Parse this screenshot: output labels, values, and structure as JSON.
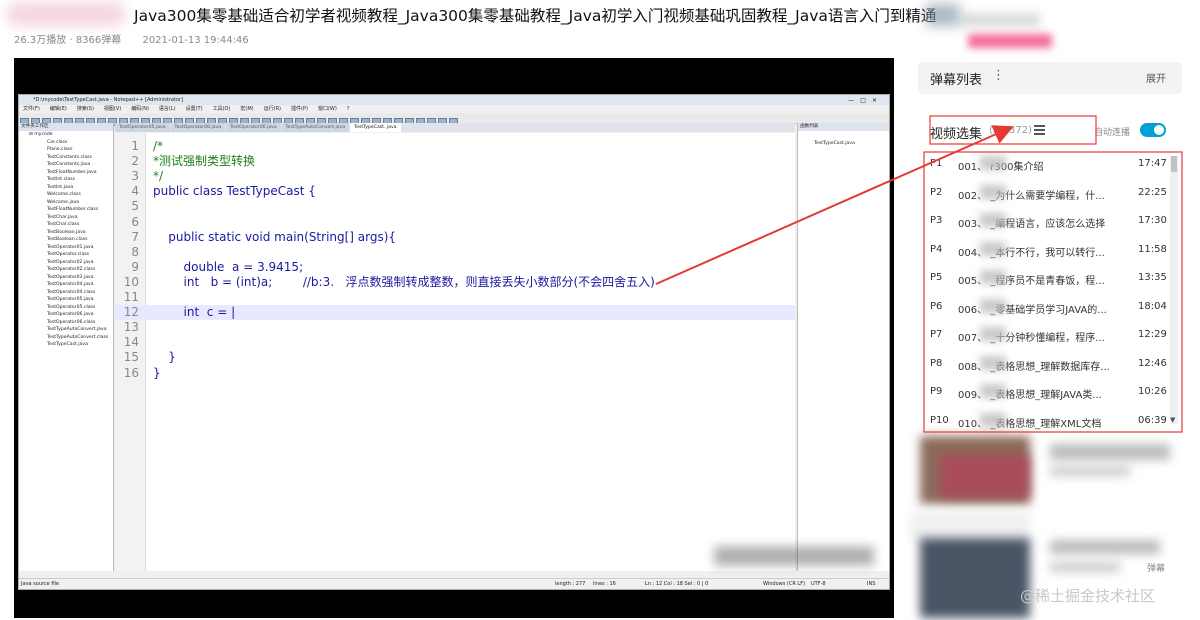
{
  "header": {
    "title": "Java300集零基础适合初学者视频教程_Java300集零基础教程_Java初学入门视频基础巩固教程_Java语言入门到精通",
    "plays": "26.3万播放",
    "danmaku_count": "8366弹幕",
    "date": "2021-01-13 19:44:46",
    "separator": " · "
  },
  "player": {
    "npp_title": "*D:\\mycode\\TestTypeCast.java - Notepad++ [Administrator]",
    "npp_menu": [
      "文件(F)",
      "编辑(E)",
      "搜索(S)",
      "视图(V)",
      "编码(N)",
      "语言(L)",
      "设置(T)",
      "工具(O)",
      "宏(M)",
      "运行(R)",
      "插件(P)",
      "窗口(W)",
      "?"
    ],
    "panel_title": "文件夹工作区",
    "folder": "mycode",
    "files": [
      "Car.class",
      "Plane.class",
      "TestConstants.class",
      "TestConstants.java",
      "TestFloatNumber.java",
      "TestInt.class",
      "TestInt.java",
      "Welcome.class",
      "Welcome.java",
      "TestFloatNumber.class",
      "TestChar.java",
      "TestChar.class",
      "TestBoolean.java",
      "TestBoolean.class",
      "TestOperator01.java",
      "TestOperator.class",
      "TestOperator02.java",
      "TestOperator02.class",
      "TestOperator03.java",
      "TestOperator04.java",
      "TestOperator04.class",
      "TestOperator05.java",
      "TestOperator05.class",
      "TestOperator06.java",
      "TestOperator06.class",
      "TestTypeAutoConvert.java",
      "TestTypeAutoConvert.class",
      "TestTypeCast.java"
    ],
    "tabs": [
      "TestOperator05.java",
      "TestOperator06.java",
      "TestOperator06.java",
      "TestTypeAutoConvert.java",
      "TestTypeCast. java"
    ],
    "right_panel_title": "函数列表",
    "right_panel_file": "TestTypeCast.java",
    "code_lines": [
      {
        "n": "1",
        "t": "/*"
      },
      {
        "n": "2",
        "t": "*测试强制类型转换"
      },
      {
        "n": "3",
        "t": "*/"
      },
      {
        "n": "4",
        "t": "public class TestTypeCast {"
      },
      {
        "n": "5",
        "t": ""
      },
      {
        "n": "6",
        "t": ""
      },
      {
        "n": "7",
        "t": "    public static void main(String[] args){"
      },
      {
        "n": "8",
        "t": ""
      },
      {
        "n": "9",
        "t": "        double  a = 3.9415;"
      },
      {
        "n": "10",
        "t": "        int   b = (int)a;        //b:3.   浮点数强制转成整数，则直接丢失小数部分(不会四舍五入)"
      },
      {
        "n": "11",
        "t": ""
      },
      {
        "n": "12",
        "t": "        int  c = |"
      },
      {
        "n": "13",
        "t": ""
      },
      {
        "n": "14",
        "t": ""
      },
      {
        "n": "15",
        "t": "    }"
      },
      {
        "n": "16",
        "t": "}"
      }
    ],
    "status": {
      "type": "Java source file",
      "length": "length : 277",
      "lines": "lines : 16",
      "pos": "Ln : 12   Col : 18   Sel : 0 | 0",
      "eol": "Windows (CR LF)",
      "enc": "UTF-8",
      "ins": "INS"
    }
  },
  "sidebar": {
    "danmaku_list_title": "弹幕列表",
    "danmaku_menu_icon": "⋮",
    "danmaku_expand": "展开",
    "playlist_title": "视频选集",
    "playlist_count": "(50/372)",
    "autoplay_label": "自动连播",
    "autoplay_on": true,
    "items": [
      {
        "p": "P1",
        "text": "001、     r300集介绍",
        "dur": "17:47"
      },
      {
        "p": "P2",
        "text": "002、      _为什么需要学编程，什...",
        "dur": "22:25"
      },
      {
        "p": "P3",
        "text": "003、      _编程语言，应该怎么选择",
        "dur": "17:30"
      },
      {
        "p": "P4",
        "text": "004、      _本行不行，我可以转行...",
        "dur": "11:58"
      },
      {
        "p": "P5",
        "text": "005、      _程序员不是青春饭，程...",
        "dur": "13:35"
      },
      {
        "p": "P6",
        "text": "006、      _零基础学员学习JAVA的...",
        "dur": "18:04"
      },
      {
        "p": "P7",
        "text": "007、      _十分钟秒懂编程，程序...",
        "dur": "12:29"
      },
      {
        "p": "P8",
        "text": "008、      _表格思想_理解数据库存...",
        "dur": "12:46"
      },
      {
        "p": "P9",
        "text": "009、      _表格思想_理解JAVA类...",
        "dur": "10:26"
      },
      {
        "p": "P10",
        "text": "010、      _表格思想_理解XML文档",
        "dur": "06:39"
      }
    ]
  },
  "watermark": "@稀土掘金技术社区",
  "danmu_tag": "弹幕",
  "colors": {
    "accent": "#00a1d6",
    "annotation": "#e53935"
  },
  "icons": {
    "list": "list-icon",
    "toggle": "toggle-switch",
    "more": "more-vertical-icon"
  }
}
